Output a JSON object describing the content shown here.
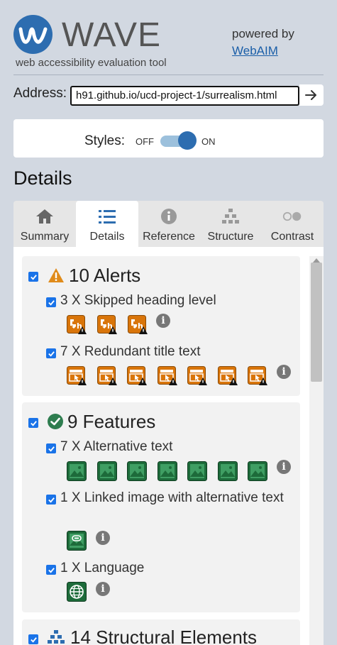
{
  "header": {
    "logo_text": "WAVE",
    "tagline": "web accessibility evaluation tool",
    "powered_by": "powered by",
    "webaim_link": "WebAIM"
  },
  "address": {
    "label": "Address:",
    "value": "h91.github.io/ucd-project-1/surrealism.html"
  },
  "styles": {
    "label": "Styles:",
    "off": "OFF",
    "on": "ON",
    "state": "on"
  },
  "details_heading": "Details",
  "tabs": [
    {
      "label": "Summary",
      "icon": "home-icon"
    },
    {
      "label": "Details",
      "icon": "list-icon",
      "active": true
    },
    {
      "label": "Reference",
      "icon": "info-icon"
    },
    {
      "label": "Structure",
      "icon": "hierarchy-icon"
    },
    {
      "label": "Contrast",
      "icon": "contrast-icon"
    }
  ],
  "alerts": {
    "title": "10 Alerts",
    "items": [
      {
        "label": "3 X Skipped heading level",
        "count": 3,
        "icon": "skipped-heading-icon"
      },
      {
        "label": "7 X Redundant title text",
        "count": 7,
        "icon": "redundant-title-icon"
      }
    ]
  },
  "features": {
    "title": "9 Features",
    "items": [
      {
        "label": "7 X Alternative text",
        "count": 7,
        "icon": "image-alt-icon"
      },
      {
        "label": "1 X Linked image with alternative text",
        "count": 1,
        "icon": "linked-image-icon"
      },
      {
        "label": "1 X Language",
        "count": 1,
        "icon": "language-icon"
      }
    ]
  },
  "structural": {
    "title": "14 Structural Elements"
  },
  "colors": {
    "brand_blue": "#2d6db0",
    "alert_orange": "#d9750a",
    "feature_green": "#1d6b3a",
    "checkbox_blue": "#1a73e8"
  }
}
